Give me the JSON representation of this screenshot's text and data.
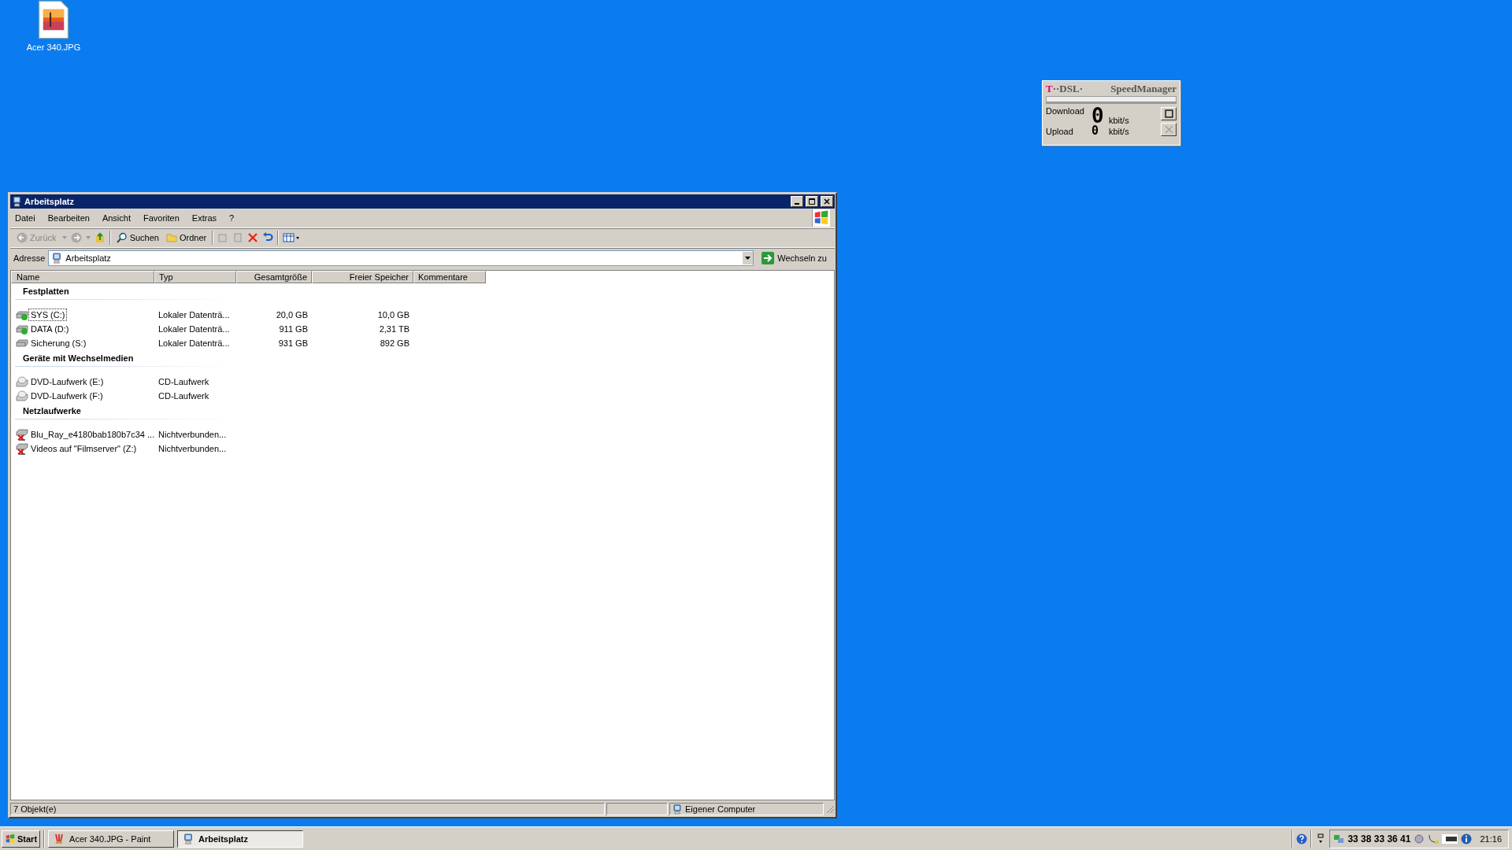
{
  "desktop_icons": [
    {
      "label": "Acer 340.JPG"
    }
  ],
  "speed_manager": {
    "brand_mark": "T",
    "brand": "··DSL·",
    "title": "SpeedManager",
    "download_label": "Download",
    "download_value": "0",
    "download_unit": "kbit/s",
    "upload_label": "Upload",
    "upload_value": "0",
    "upload_unit": "kbit/s"
  },
  "window": {
    "title": "Arbeitsplatz",
    "menu": [
      "Datei",
      "Bearbeiten",
      "Ansicht",
      "Favoriten",
      "Extras",
      "?"
    ],
    "toolbar": {
      "back": "Zurück",
      "search": "Suchen",
      "folders": "Ordner"
    },
    "address": {
      "label": "Adresse",
      "value": "Arbeitsplatz",
      "go": "Wechseln zu"
    },
    "columns": [
      {
        "label": "Name",
        "kind": "text"
      },
      {
        "label": "Typ",
        "kind": "text"
      },
      {
        "label": "Gesamtgröße",
        "kind": "number"
      },
      {
        "label": "Freier Speicher",
        "kind": "number"
      },
      {
        "label": "Kommentare",
        "kind": "text"
      }
    ],
    "groups": [
      {
        "title": "Festplatten",
        "items": [
          {
            "kind": "disk",
            "badge": true,
            "selected": true,
            "name": "SYS (C:)",
            "type": "Lokaler Datenträ...",
            "total": "20,0 GB",
            "free": "10,0 GB"
          },
          {
            "kind": "disk",
            "badge": true,
            "selected": false,
            "name": "DATA (D:)",
            "type": "Lokaler Datenträ...",
            "total": "911 GB",
            "free": "2,31 TB"
          },
          {
            "kind": "disk",
            "badge": false,
            "selected": false,
            "name": "Sicherung (S:)",
            "type": "Lokaler Datenträ...",
            "total": "931 GB",
            "free": "892 GB"
          }
        ]
      },
      {
        "title": "Geräte mit Wechselmedien",
        "items": [
          {
            "kind": "dvd",
            "badge": false,
            "selected": false,
            "name": "DVD-Laufwerk (E:)",
            "type": "CD-Laufwerk"
          },
          {
            "kind": "dvd",
            "badge": false,
            "selected": false,
            "name": "DVD-Laufwerk (F:)",
            "type": "CD-Laufwerk"
          }
        ]
      },
      {
        "title": "Netzlaufwerke",
        "items": [
          {
            "kind": "network",
            "badge": false,
            "selected": false,
            "name": "Blu_Ray_e4180bab180b7c34 ...",
            "type": "Nichtverbunden..."
          },
          {
            "kind": "network",
            "badge": false,
            "selected": false,
            "name": "Videos auf \"Filmserver\" (Z:)",
            "type": "Nichtverbunden..."
          }
        ]
      }
    ],
    "status_bar": {
      "count": "7 Objekt(e)",
      "zone": "Eigener Computer"
    }
  },
  "taskbar": {
    "start": "Start",
    "tasks": [
      {
        "label": "Acer 340.JPG - Paint",
        "kind": "paint",
        "selected": false
      },
      {
        "label": "Arbeitsplatz",
        "kind": "computer",
        "selected": true
      }
    ],
    "tray": {
      "numbers": "33 38 33 36 41",
      "clock": "21:16"
    }
  }
}
